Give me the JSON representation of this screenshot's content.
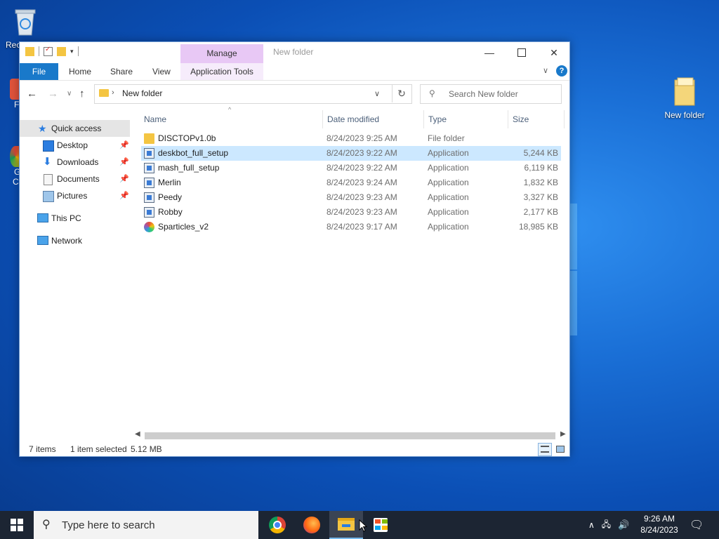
{
  "desktop": {
    "recycle_label": "Rec",
    "newfolder_label": "New folder",
    "partial_labels": [
      "F",
      "G",
      "C"
    ]
  },
  "window": {
    "title": "New folder",
    "manage_tab": "Manage",
    "ribbon": {
      "file": "File",
      "home": "Home",
      "share": "Share",
      "view": "View",
      "app_tools": "Application Tools"
    },
    "address": "New folder",
    "search_placeholder": "Search New folder",
    "nav_pane": {
      "quick_access": "Quick access",
      "desktop": "Desktop",
      "downloads": "Downloads",
      "documents": "Documents",
      "pictures": "Pictures",
      "this_pc": "This PC",
      "network": "Network"
    },
    "columns": {
      "name": "Name",
      "date": "Date modified",
      "type": "Type",
      "size": "Size"
    },
    "files": [
      {
        "name": "DISCTOPv1.0b",
        "date": "8/24/2023 9:25 AM",
        "type": "File folder",
        "size": "",
        "icon": "folder-icon"
      },
      {
        "name": "deskbot_full_setup",
        "date": "8/24/2023 9:22 AM",
        "type": "Application",
        "size": "5,244 KB",
        "icon": "installer-icon"
      },
      {
        "name": "mash_full_setup",
        "date": "8/24/2023 9:22 AM",
        "type": "Application",
        "size": "6,119 KB",
        "icon": "installer-icon"
      },
      {
        "name": "Merlin",
        "date": "8/24/2023 9:24 AM",
        "type": "Application",
        "size": "1,832 KB",
        "icon": "app-icon"
      },
      {
        "name": "Peedy",
        "date": "8/24/2023 9:23 AM",
        "type": "Application",
        "size": "3,327 KB",
        "icon": "app-icon"
      },
      {
        "name": "Robby",
        "date": "8/24/2023 9:23 AM",
        "type": "Application",
        "size": "2,177 KB",
        "icon": "app-icon"
      },
      {
        "name": "Sparticles_v2",
        "date": "8/24/2023 9:17 AM",
        "type": "Application",
        "size": "18,985 KB",
        "icon": "sparticles-icon"
      }
    ],
    "status": {
      "items": "7 items",
      "selected": "1 item selected",
      "size": "5.12 MB"
    }
  },
  "taskbar": {
    "search_placeholder": "Type here to search",
    "time": "9:26 AM",
    "date": "8/24/2023"
  }
}
